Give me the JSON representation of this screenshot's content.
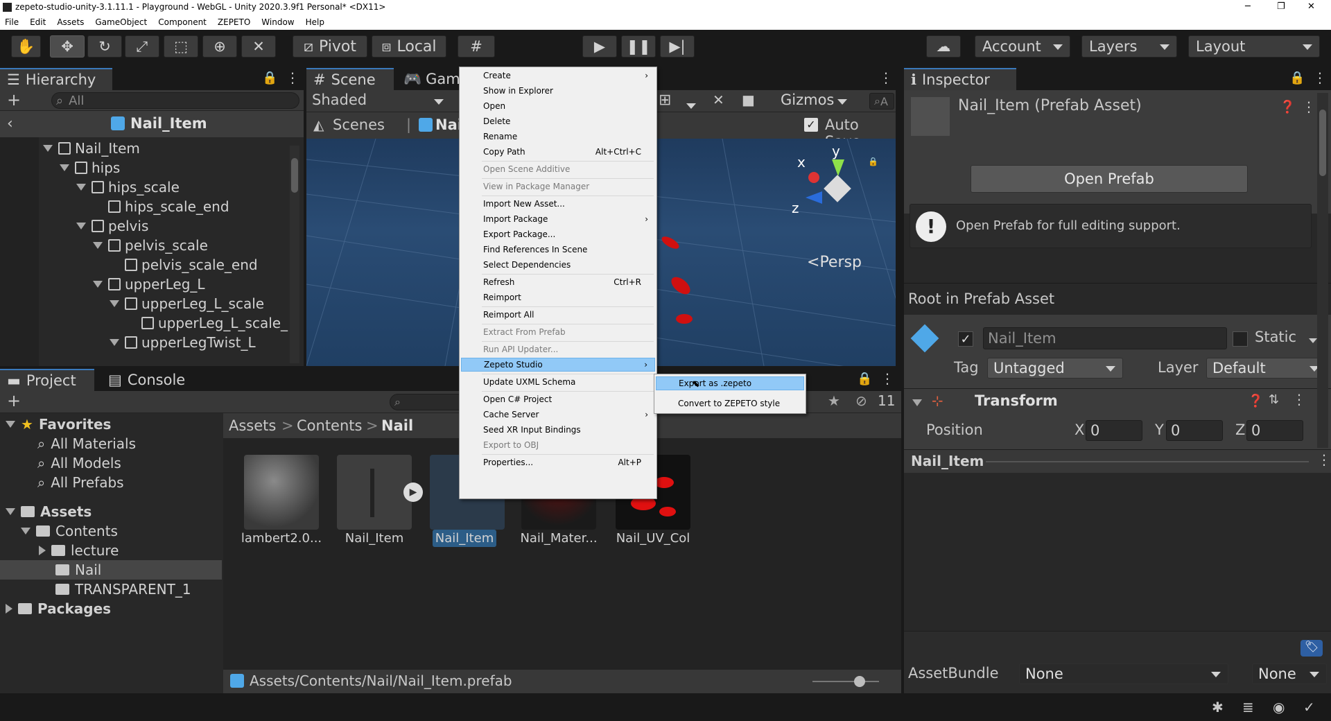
{
  "window": {
    "title": "zepeto-studio-unity-3.1.11.1 - Playground - WebGL - Unity 2020.3.9f1 Personal* <DX11>",
    "minimize": "─",
    "maximize": "❐",
    "close": "✕"
  },
  "menubar": [
    "File",
    "Edit",
    "Assets",
    "GameObject",
    "Component",
    "ZEPETO",
    "Window",
    "Help"
  ],
  "toolbar": {
    "pivot": "Pivot",
    "local": "Local",
    "account": "Account",
    "layers": "Layers",
    "layout": "Layout"
  },
  "hierarchy": {
    "tab": "Hierarchy",
    "search_placeholder": "All",
    "prefab_header": "Nail_Item",
    "rows": [
      {
        "label": "Nail_Item",
        "depth": 0
      },
      {
        "label": "hips",
        "depth": 1
      },
      {
        "label": "hips_scale",
        "depth": 2
      },
      {
        "label": "hips_scale_end",
        "depth": 3
      },
      {
        "label": "pelvis",
        "depth": 2
      },
      {
        "label": "pelvis_scale",
        "depth": 3
      },
      {
        "label": "pelvis_scale_end",
        "depth": 4
      },
      {
        "label": "upperLeg_L",
        "depth": 3
      },
      {
        "label": "upperLeg_L_scale",
        "depth": 4
      },
      {
        "label": "upperLeg_L_scale_",
        "depth": 5
      },
      {
        "label": "upperLegTwist_L",
        "depth": 4
      }
    ]
  },
  "scene": {
    "tab_scene": "Scene",
    "tab_game": "Gam",
    "shading": "Shaded",
    "breadcrumb_scenes": "Scenes",
    "breadcrumb_item": "Nail_",
    "gizmos": "Gizmos",
    "auto_save": "Auto Save",
    "persp": "Persp",
    "axis_x": "x",
    "axis_y": "y",
    "axis_z": "z",
    "search_placeholder": "A"
  },
  "context_menu": [
    {
      "label": "Create",
      "arrow": true
    },
    {
      "label": "Show in Explorer"
    },
    {
      "label": "Open"
    },
    {
      "label": "Delete"
    },
    {
      "label": "Rename"
    },
    {
      "label": "Copy Path",
      "shortcut": "Alt+Ctrl+C"
    },
    {
      "sep": true
    },
    {
      "label": "Open Scene Additive",
      "disabled": true
    },
    {
      "sep": true
    },
    {
      "label": "View in Package Manager",
      "disabled": true
    },
    {
      "sep": true
    },
    {
      "label": "Import New Asset..."
    },
    {
      "label": "Import Package",
      "arrow": true
    },
    {
      "label": "Export Package..."
    },
    {
      "label": "Find References In Scene"
    },
    {
      "label": "Select Dependencies"
    },
    {
      "sep": true
    },
    {
      "label": "Refresh",
      "shortcut": "Ctrl+R"
    },
    {
      "label": "Reimport"
    },
    {
      "sep": true
    },
    {
      "label": "Reimport All"
    },
    {
      "sep": true
    },
    {
      "label": "Extract From Prefab",
      "disabled": true
    },
    {
      "sep": true
    },
    {
      "label": "Run API Updater...",
      "disabled": true
    },
    {
      "label": "Zepeto Studio",
      "arrow": true,
      "highlight": true
    },
    {
      "sep": true
    },
    {
      "label": "Update UXML Schema"
    },
    {
      "sep": true
    },
    {
      "label": "Open C# Project"
    },
    {
      "label": "Cache Server",
      "arrow": true
    },
    {
      "label": "Seed XR Input Bindings"
    },
    {
      "label": "Export to OBJ",
      "disabled": true
    },
    {
      "sep": true
    },
    {
      "label": "Properties...",
      "shortcut": "Alt+P"
    }
  ],
  "submenu": [
    {
      "label": "Export as .zepeto",
      "highlight": true
    },
    {
      "label": "Convert to ZEPETO style"
    }
  ],
  "project": {
    "tab_project": "Project",
    "tab_console": "Console",
    "hidden_count": "11",
    "favorites": "Favorites",
    "fav_items": [
      "All Materials",
      "All Models",
      "All Prefabs"
    ],
    "assets": "Assets",
    "contents": "Contents",
    "folders": [
      "lecture",
      "Nail",
      "TRANSPARENT_1"
    ],
    "packages": "Packages",
    "breadcrumb": [
      "Assets",
      "Contents",
      "Nail"
    ],
    "items": [
      "lambert2.0...",
      "Nail_Item",
      "Nail_Item",
      "Nail_Mater...",
      "Nail_UV_Col"
    ],
    "path": "Assets/Contents/Nail/Nail_Item.prefab",
    "zoom": 0.7
  },
  "inspector": {
    "tab": "Inspector",
    "title": "Nail_Item (Prefab Asset)",
    "open_prefab": "Open Prefab",
    "info": "Open Prefab for full editing support.",
    "root_label": "Root in Prefab Asset",
    "name": "Nail_Item",
    "static": "Static",
    "tag_label": "Tag",
    "tag": "Untagged",
    "layer_label": "Layer",
    "layer": "Default",
    "transform": "Transform",
    "position": "Position",
    "x": "0",
    "y": "0",
    "z": "0",
    "px": "X",
    "py": "Y",
    "pz": "Z",
    "preview_title": "Nail_Item",
    "assetbundle_label": "AssetBundle",
    "assetbundle": "None",
    "variant": "None"
  }
}
